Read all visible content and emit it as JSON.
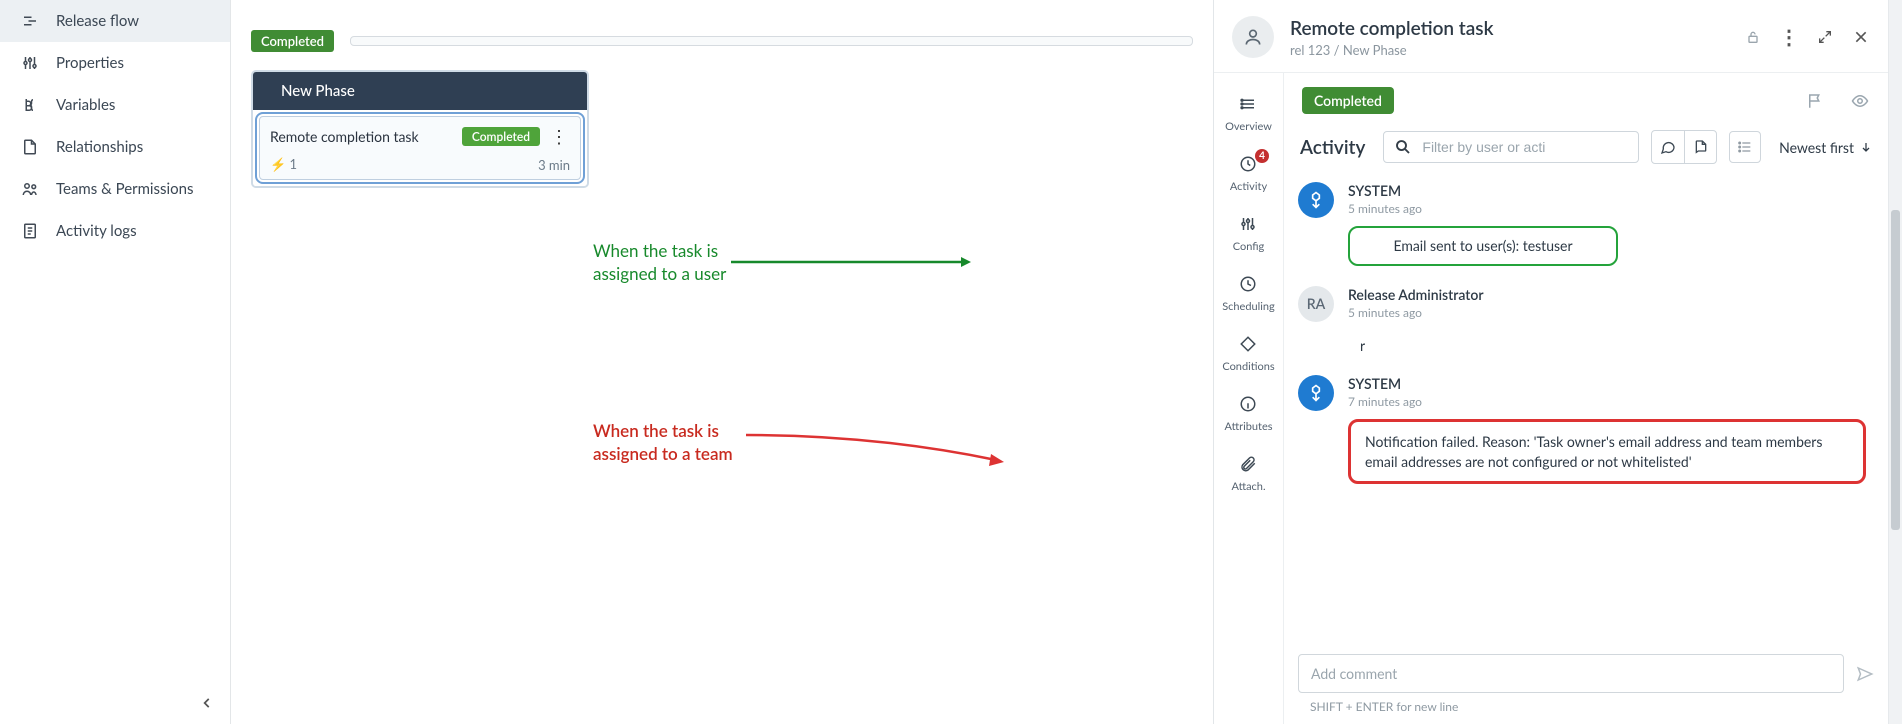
{
  "sidebar": {
    "items": [
      {
        "label": "Release flow"
      },
      {
        "label": "Properties"
      },
      {
        "label": "Variables"
      },
      {
        "label": "Relationships"
      },
      {
        "label": "Teams & Permissions"
      },
      {
        "label": "Activity logs"
      }
    ]
  },
  "canvas": {
    "status": "Completed",
    "phase_title": "New Phase",
    "task": {
      "title": "Remote completion task",
      "status": "Completed",
      "count": "1",
      "duration": "3 min"
    }
  },
  "annotations": {
    "user_note": "When the task is\nassigned to a user",
    "team_note": "When the task is\nassigned to a team"
  },
  "details": {
    "title": "Remote completion task",
    "breadcrumb": "rel 123 / New Phase",
    "nav": {
      "overview": "Overview",
      "activity": "Activity",
      "activity_badge": "4",
      "config": "Config",
      "scheduling": "Scheduling",
      "conditions": "Conditions",
      "attributes": "Attributes",
      "attach": "Attach."
    },
    "status": "Completed",
    "activity_heading": "Activity",
    "filter_placeholder": "Filter by user or acti",
    "sort_label": "Newest first",
    "items": [
      {
        "user": "SYSTEM",
        "time": "5 minutes ago",
        "msg": "Email sent to user(s): testuser",
        "kind": "green",
        "avatar": "sys"
      },
      {
        "user": "Release Administrator",
        "time": "5 minutes ago",
        "msg": "r",
        "kind": "plain",
        "avatar": "ra",
        "avatar_text": "RA"
      },
      {
        "user": "SYSTEM",
        "time": "7 minutes ago",
        "msg": "Notification failed. Reason: 'Task owner's email address and team members email addresses are not configured or not whitelisted'",
        "kind": "red",
        "avatar": "sys"
      }
    ],
    "comment_placeholder": "Add comment",
    "comment_hint": "SHIFT + ENTER for new line"
  }
}
